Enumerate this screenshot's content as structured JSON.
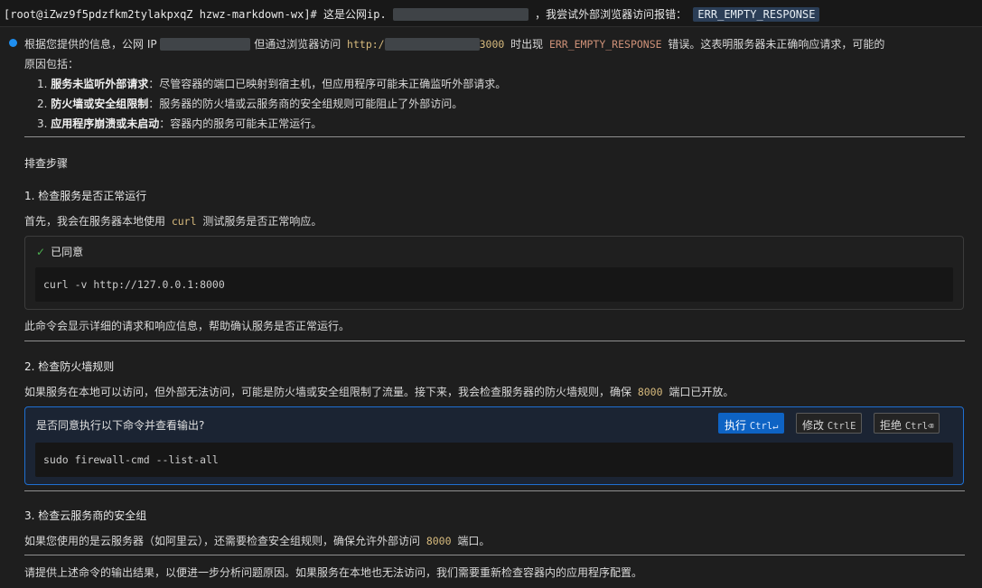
{
  "prompt": {
    "user_host": "[root@iZwz9f5pdzfkm2tylakpxqZ hzwz-markdown-wx]#",
    "text_a": "这是公网ip.",
    "text_b": "，我尝试外部浏览器访问报错：",
    "error_token": "ERR_EMPTY_RESPONSE"
  },
  "intro": {
    "p1_a": "根据您提供的信息，公网 IP ",
    "p1_b": " 但通过浏览器访问 ",
    "url_prefix": "http:/",
    "url_suffix": "3000",
    "p1_c": " 时出现 ",
    "error_code": "ERR_EMPTY_RESPONSE",
    "p1_d": " 错误。这表明服务器未正确响应请求，可能的",
    "p1_line2": "原因包括："
  },
  "reasons": [
    {
      "num": "1.",
      "bold": "服务未监听外部请求",
      "text": "：尽管容器的端口已映射到宿主机，但应用程序可能未正确监听外部请求。"
    },
    {
      "num": "2.",
      "bold": "防火墙或安全组限制",
      "text": "：服务器的防火墙或云服务商的安全组规则可能阻止了外部访问。"
    },
    {
      "num": "3.",
      "bold": "应用程序崩溃或未启动",
      "text": "：容器内的服务可能未正常运行。"
    }
  ],
  "troubleshoot_title": "排查步骤",
  "step1": {
    "title": "1. 检查服务是否正常运行",
    "desc_a": "首先，我会在服务器本地使用 ",
    "desc_code": "curl",
    "desc_b": " 测试服务是否正常响应。",
    "card_status": "已同意",
    "command": "curl -v http://127.0.0.1:8000",
    "after": "此命令会显示详细的请求和响应信息，帮助确认服务是否正常运行。"
  },
  "step2": {
    "title": "2. 检查防火墙规则",
    "desc_a": "如果服务在本地可以访问，但外部无法访问，可能是防火墙或安全组限制了流量。接下来，我会检查服务器的防火墙规则，确保 ",
    "desc_code": "8000",
    "desc_b": " 端口已开放。",
    "card_question": "是否同意执行以下命令并查看输出?",
    "command": "sudo firewall-cmd --list-all",
    "buttons": [
      {
        "label": "执行",
        "shortcut": "Ctrl↵"
      },
      {
        "label": "修改",
        "shortcut": "CtrlE"
      },
      {
        "label": "拒绝",
        "shortcut": "Ctrl⌫"
      }
    ]
  },
  "step3": {
    "title": "3. 检查云服务商的安全组",
    "desc_a": "如果您使用的是云服务器（如阿里云），还需要检查安全组规则，确保允许外部访问 ",
    "desc_code": "8000",
    "desc_b": " 端口。"
  },
  "closing": "请提供上述命令的输出结果，以便进一步分析问题原因。如果服务在本地也无法访问，我们需要重新检查容器内的应用程序配置。",
  "colors": {
    "accent": "#0e63c4",
    "bullet": "#1f8ff0",
    "check": "#4caf50",
    "inline_code": "#d7ba7d"
  },
  "icons": {
    "bullet": "status-dot-icon",
    "check": "check-icon"
  }
}
